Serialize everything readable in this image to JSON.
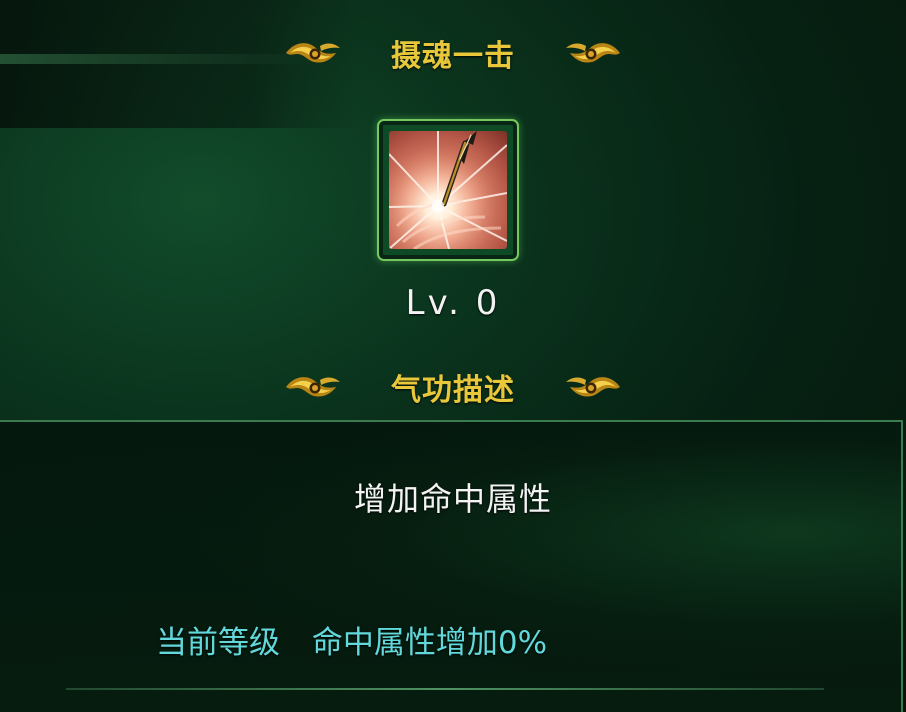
{
  "skill": {
    "name": "摄魂一击",
    "level": "Lv. 0",
    "icon": "arrow-impact-skill-icon"
  },
  "description": {
    "heading": "气功描述",
    "text": "增加命中属性"
  },
  "current_level": {
    "label": "当前等级",
    "value": "命中属性增加0%"
  },
  "ornaments": {
    "left_icon": "gold-cloud-ornament-left-icon",
    "right_icon": "gold-cloud-ornament-right-icon"
  },
  "colors": {
    "gold": "#e8c73a",
    "white": "#f3f3f3",
    "cyan": "#62d8da",
    "frame_green": "#74c85f"
  }
}
